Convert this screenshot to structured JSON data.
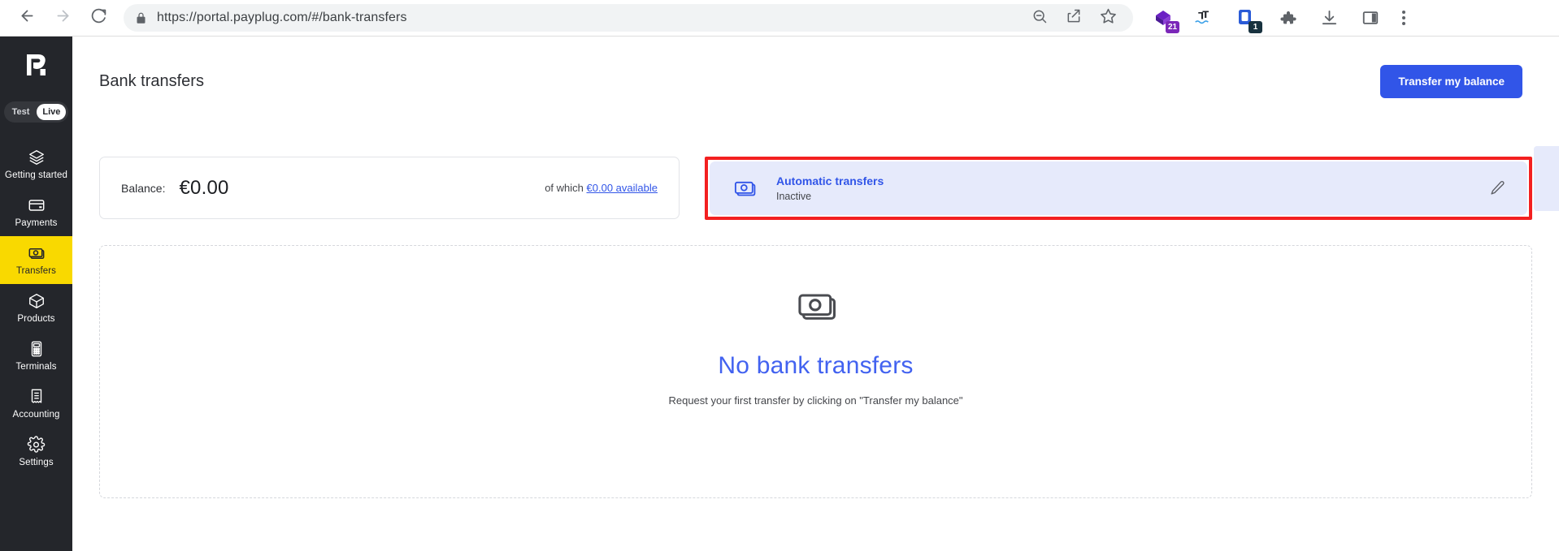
{
  "browser": {
    "back_icon": "back-arrow-icon",
    "forward_icon": "forward-arrow-icon",
    "reload_icon": "reload-icon",
    "lock_icon": "lock-icon",
    "url": "https://portal.payplug.com/#/bank-transfers",
    "zoom_out_icon": "zoom-out-icon",
    "share_icon": "share-icon",
    "bookmark_icon": "star-icon",
    "extensions": [
      {
        "name": "purple-diamond-extension-icon",
        "badge": "21",
        "badge_style": "purple"
      },
      {
        "name": "languagetool-extension-icon",
        "badge": "",
        "badge_style": ""
      },
      {
        "name": "notes-extension-icon",
        "badge": "1",
        "badge_style": "dark"
      },
      {
        "name": "puzzle-extensions-icon",
        "badge": "",
        "badge_style": ""
      },
      {
        "name": "download-icon",
        "badge": "",
        "badge_style": ""
      },
      {
        "name": "side-panel-icon",
        "badge": "",
        "badge_style": ""
      }
    ],
    "menu_icon": "three-dot-menu-icon"
  },
  "sidebar": {
    "logo": "payplug-logo",
    "mode_toggle": {
      "test_label": "Test",
      "live_label": "Live",
      "active": "Live"
    },
    "items": [
      {
        "label": "Getting started",
        "icon": "layers-icon",
        "active": false
      },
      {
        "label": "Payments",
        "icon": "credit-card-icon",
        "active": false
      },
      {
        "label": "Transfers",
        "icon": "banknotes-icon",
        "active": true
      },
      {
        "label": "Products",
        "icon": "box-icon",
        "active": false
      },
      {
        "label": "Terminals",
        "icon": "payment-terminal-icon",
        "active": false
      },
      {
        "label": "Accounting",
        "icon": "receipt-icon",
        "active": false
      },
      {
        "label": "Settings",
        "icon": "gear-icon",
        "active": false
      }
    ]
  },
  "header": {
    "title": "Bank transfers",
    "primary_button": "Transfer my balance"
  },
  "balance_card": {
    "label": "Balance:",
    "value": "€0.00",
    "available_prefix": "of which",
    "available_link": "€0.00 available"
  },
  "automatic_transfers": {
    "icon": "banknotes-icon",
    "title": "Automatic transfers",
    "status": "Inactive",
    "edit_icon": "pencil-icon",
    "highlight_color": "#f32020"
  },
  "empty_state": {
    "icon": "banknotes-icon",
    "title": "No bank transfers",
    "subtitle": "Request your first transfer by clicking on \"Transfer my balance\""
  },
  "colors": {
    "accent_blue": "#3155e8",
    "sidebar_bg": "#24262b",
    "active_yellow": "#f9d900",
    "card_blue_bg": "#e6eafb"
  }
}
